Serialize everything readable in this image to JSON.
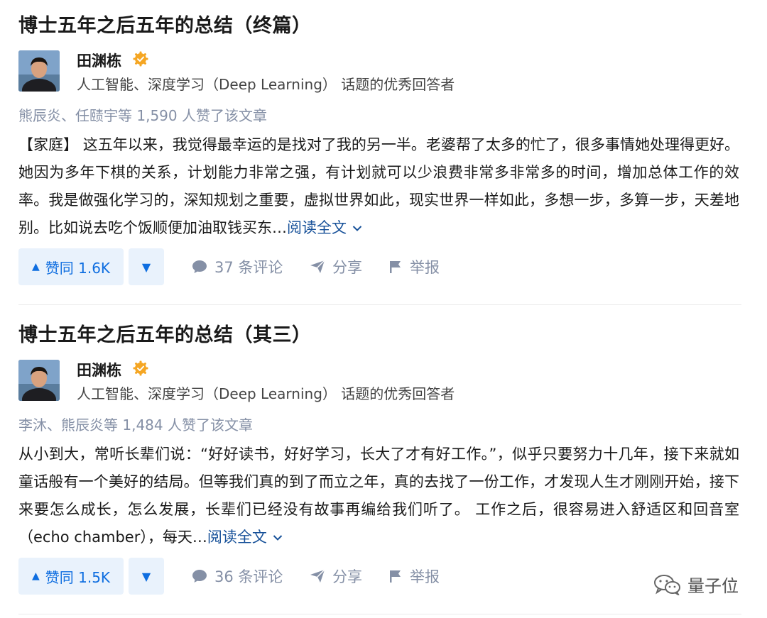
{
  "articles": [
    {
      "title": "博士五年之后五年的总结（终篇）",
      "author": {
        "name": "田渊栋",
        "headline": "人工智能、深度学习（Deep Learning） 话题的优秀回答者"
      },
      "voters": "熊辰炎、任赜宇等 1,590 人赞了该文章",
      "excerpt": "【家庭】 这五年以来，我觉得最幸运的是找对了我的另一半。老婆帮了太多的忙了，很多事情她处理得更好。她因为多年下棋的关系，计划能力非常之强，有计划就可以少浪费非常多非常多的时间，增加总体工作的效率。我是做强化学习的，深知规划之重要，虚拟世界如此，现实世界一样如此，多想一步，多算一步，天差地别。比如说去吃个饭顺便加油取钱买东…",
      "read_more": "阅读全文",
      "upvote": "赞同 1.6K",
      "comments": "37 条评论",
      "share": "分享",
      "report": "举报"
    },
    {
      "title": "博士五年之后五年的总结（其三）",
      "author": {
        "name": "田渊栋",
        "headline": "人工智能、深度学习（Deep Learning） 话题的优秀回答者"
      },
      "voters": "李沐、熊辰炎等 1,484 人赞了该文章",
      "excerpt": "从小到大，常听长辈们说：“好好读书，好好学习，长大了才有好工作。”，似乎只要努力十几年，接下来就如童话般有一个美好的结局。但等我们真的到了而立之年，真的去找了一份工作，才发现人生才刚刚开始，接下来要怎么成长，怎么发展，长辈们已经没有故事再编给我们听了。 工作之后，很容易进入舒适区和回音室（echo chamber），每天…",
      "read_more": "阅读全文",
      "upvote": "赞同 1.5K",
      "comments": "36 条评论",
      "share": "分享",
      "report": "举报"
    }
  ],
  "watermark": "量子位",
  "icons": {
    "badge": "orange-gear-badge-icon",
    "comment": "comment-bubble-icon",
    "share": "paper-plane-icon",
    "report": "flag-icon",
    "upvote": "triangle-up-icon",
    "downvote": "triangle-down-icon",
    "chevron": "chevron-down-icon"
  },
  "colors": {
    "link": "#175199",
    "vote_bg": "#e9f2fc",
    "vote_fg": "#0f6ee0",
    "muted": "#8590a6",
    "badge": "#f5a623"
  }
}
